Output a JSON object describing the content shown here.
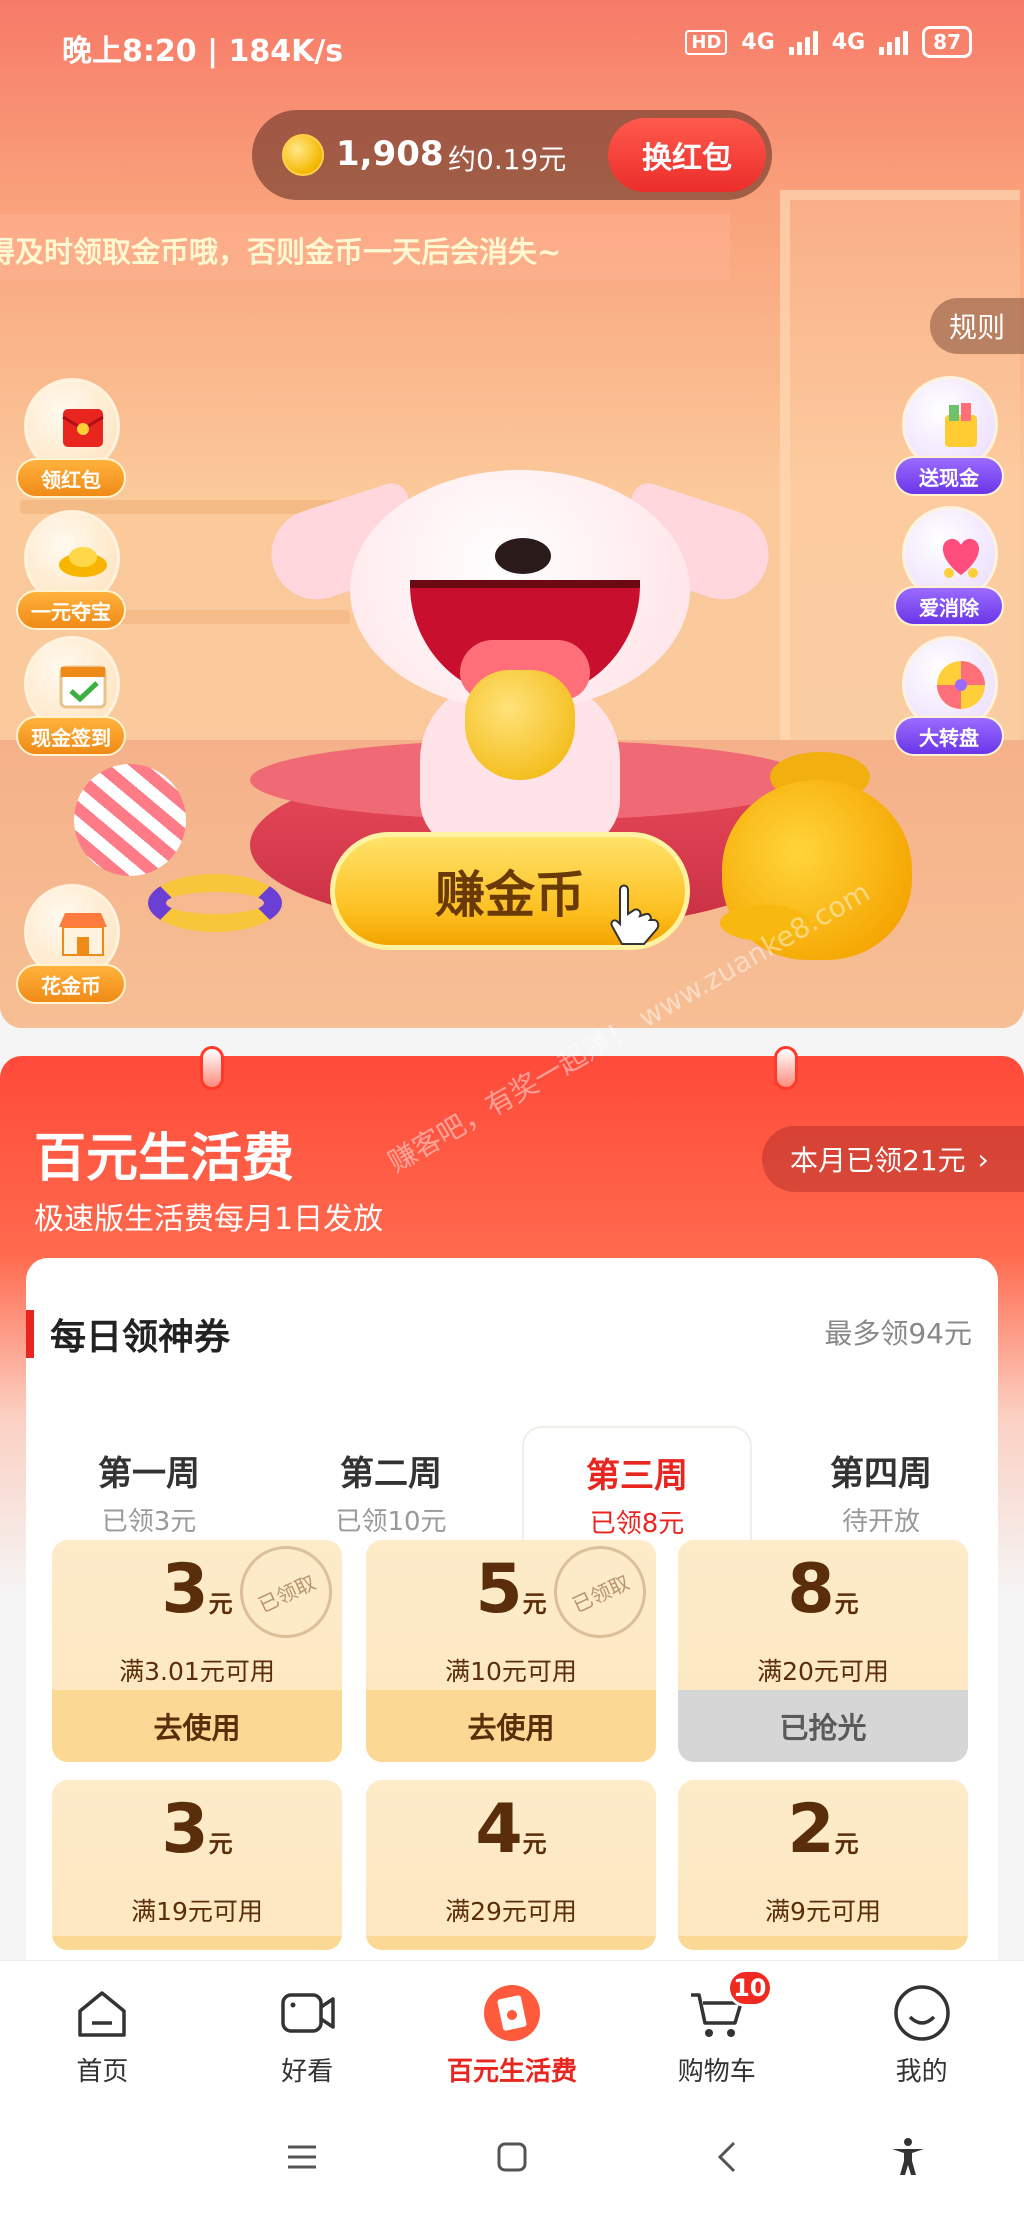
{
  "status_bar": {
    "time": "晚上8:20 | 184K/s",
    "hd": "HD",
    "net1": "4G",
    "net2": "4G",
    "battery": "87"
  },
  "coins": {
    "count": "1,908",
    "approx": "约0.19元",
    "redeem_label": "换红包"
  },
  "ticker": "得及时领取金币哦，否则金币一天后会消失~",
  "rules_label": "规则",
  "left_icons": [
    {
      "label": "领红包",
      "icon": "red-envelope-icon"
    },
    {
      "label": "一元夺宝",
      "icon": "gold-ingot-icon"
    },
    {
      "label": "现金签到",
      "icon": "calendar-check-icon"
    },
    {
      "label": "花金币",
      "icon": "shop-icon"
    }
  ],
  "right_icons": [
    {
      "label": "送现金",
      "icon": "cash-gift-icon"
    },
    {
      "label": "爱消除",
      "icon": "heart-game-icon"
    },
    {
      "label": "大转盘",
      "icon": "spin-wheel-icon"
    }
  ],
  "earn_label": "赚金币",
  "section": {
    "title": "百元生活费",
    "subtitle": "极速版生活费每月1日发放",
    "monthly": "本月已领21元",
    "watermark": "赚客吧，有奖一起赚！ www.zuanke8.com"
  },
  "card": {
    "title": "每日领神券",
    "max": "最多领94元",
    "weeks": [
      {
        "name": "第一周",
        "status": "已领3元"
      },
      {
        "name": "第二周",
        "status": "已领10元"
      },
      {
        "name": "第三周",
        "status": "已领8元"
      },
      {
        "name": "第四周",
        "status": "待开放"
      }
    ],
    "claimed_stamp": "已领取",
    "coupons": [
      {
        "amount": "3",
        "unit": "元",
        "cond": "满3.01元可用",
        "btn": "去使用"
      },
      {
        "amount": "5",
        "unit": "元",
        "cond": "满10元可用",
        "btn": "去使用"
      },
      {
        "amount": "8",
        "unit": "元",
        "cond": "满20元可用",
        "btn": "已抢光"
      },
      {
        "amount": "3",
        "unit": "元",
        "cond": "满19元可用"
      },
      {
        "amount": "4",
        "unit": "元",
        "cond": "满29元可用"
      },
      {
        "amount": "2",
        "unit": "元",
        "cond": "满9元可用"
      }
    ]
  },
  "nav": [
    {
      "label": "首页"
    },
    {
      "label": "好看"
    },
    {
      "label": "百元生活费"
    },
    {
      "label": "购物车",
      "badge": "10"
    },
    {
      "label": "我的"
    }
  ],
  "colors": {
    "accent": "#e8251f",
    "gold": "#fdbf1f",
    "coupon_bg": "#fdebc9"
  }
}
